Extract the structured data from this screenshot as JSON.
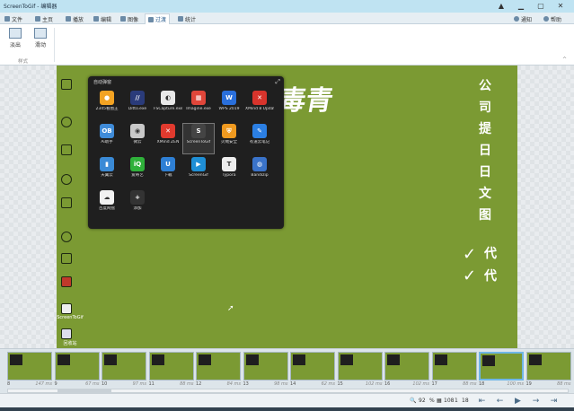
{
  "window": {
    "title": "ScreenToGif - 编辑器",
    "buttons": [
      "▲",
      "▁",
      "▢",
      "✕"
    ]
  },
  "tabs": [
    {
      "id": "file",
      "label": "文件"
    },
    {
      "id": "home",
      "label": "主页"
    },
    {
      "id": "play",
      "label": "播放"
    },
    {
      "id": "edit",
      "label": "编辑"
    },
    {
      "id": "image",
      "label": "图像"
    },
    {
      "id": "transitions",
      "label": "过渡"
    },
    {
      "id": "stats",
      "label": "统计"
    }
  ],
  "tabs_right": {
    "notify": "通知",
    "help": "帮助"
  },
  "ribbon": {
    "buttons": [
      {
        "label": "淡出"
      },
      {
        "label": "滑动"
      }
    ],
    "group_label": "样式",
    "collapse": "^"
  },
  "frame": {
    "big_title": "毒青",
    "vertical_text": [
      "公",
      "司",
      "提",
      "日",
      "日",
      "文",
      "图"
    ],
    "checks": [
      {
        "mark": "✓",
        "text": "代"
      },
      {
        "mark": "✓",
        "text": "代"
      }
    ],
    "desktop_labels": [
      "ScreenToGif",
      "回收站"
    ]
  },
  "popup": {
    "title": "自动弹窗",
    "close": "⤢",
    "apps": [
      {
        "label": "2345看图王",
        "color": "#f3a323",
        "glyph": "●",
        "selected": false
      },
      {
        "label": "Ditto.exe",
        "color": "#2a3b7a",
        "glyph": "//",
        "selected": false
      },
      {
        "label": "FSCapture.exe",
        "color": "#e8e8e8",
        "glyph": "◐",
        "selected": false
      },
      {
        "label": "Imagine.exe",
        "color": "#e0463a",
        "glyph": "▦",
        "selected": false
      },
      {
        "label": "WPS 2019",
        "color": "#2a6fdb",
        "glyph": "W",
        "selected": false
      },
      {
        "label": "XMind 8 Update 7",
        "color": "#d8342c",
        "glyph": "✕",
        "selected": false
      },
      {
        "label": "Ai助手",
        "color": "#3f8bd8",
        "glyph": "OB",
        "selected": false
      },
      {
        "label": "微云",
        "color": "#c8c8c8",
        "glyph": "◉",
        "selected": false
      },
      {
        "label": "XMind ZEN",
        "color": "#e13a2e",
        "glyph": "✕",
        "selected": false
      },
      {
        "label": "ScreenToGif",
        "color": "#444",
        "glyph": "S",
        "selected": true
      },
      {
        "label": "火绒安全",
        "color": "#f09a1f",
        "glyph": "⛨",
        "selected": false
      },
      {
        "label": "有道云笔记",
        "color": "#2b7fe3",
        "glyph": "✎",
        "selected": false
      },
      {
        "label": "天翼云",
        "color": "#3a8ad6",
        "glyph": "▮",
        "selected": false
      },
      {
        "label": "爱奇艺",
        "color": "#2fb13a",
        "glyph": "iQ",
        "selected": false
      },
      {
        "label": "下载",
        "color": "#2e7fd4",
        "glyph": "U",
        "selected": false
      },
      {
        "label": "ScreenGif",
        "color": "#1f8fd6",
        "glyph": "▶",
        "selected": false
      },
      {
        "label": "Typora",
        "color": "#eeeeee",
        "glyph": "T",
        "selected": false
      },
      {
        "label": "Bandizip",
        "color": "#3a73c9",
        "glyph": "◍",
        "selected": false
      },
      {
        "label": "百度网盘",
        "color": "#f2f2f2",
        "glyph": "☁",
        "selected": false
      },
      {
        "label": "添加",
        "color": "#333",
        "glyph": "+",
        "selected": false
      }
    ]
  },
  "filmstrip": {
    "frames": [
      {
        "num": "8",
        "ms": "147 ms"
      },
      {
        "num": "9",
        "ms": "67 ms"
      },
      {
        "num": "10",
        "ms": "97 ms"
      },
      {
        "num": "11",
        "ms": "88 ms"
      },
      {
        "num": "12",
        "ms": "84 ms"
      },
      {
        "num": "13",
        "ms": "98 ms"
      },
      {
        "num": "14",
        "ms": "62 ms"
      },
      {
        "num": "15",
        "ms": "102 ms"
      },
      {
        "num": "16",
        "ms": "102 ms"
      },
      {
        "num": "17",
        "ms": "88 ms"
      },
      {
        "num": "18",
        "ms": "100 ms"
      },
      {
        "num": "19",
        "ms": "88 ms"
      }
    ],
    "selected_index": 10
  },
  "status": {
    "zoom": "92",
    "zoom_unit": "%",
    "frame_count": "108",
    "current": "1",
    "selected": "18"
  },
  "colors": {
    "frame_bg": "#7b9a33",
    "popup_bg": "#1f1f1f",
    "selected_border": "#6fb6e6"
  }
}
